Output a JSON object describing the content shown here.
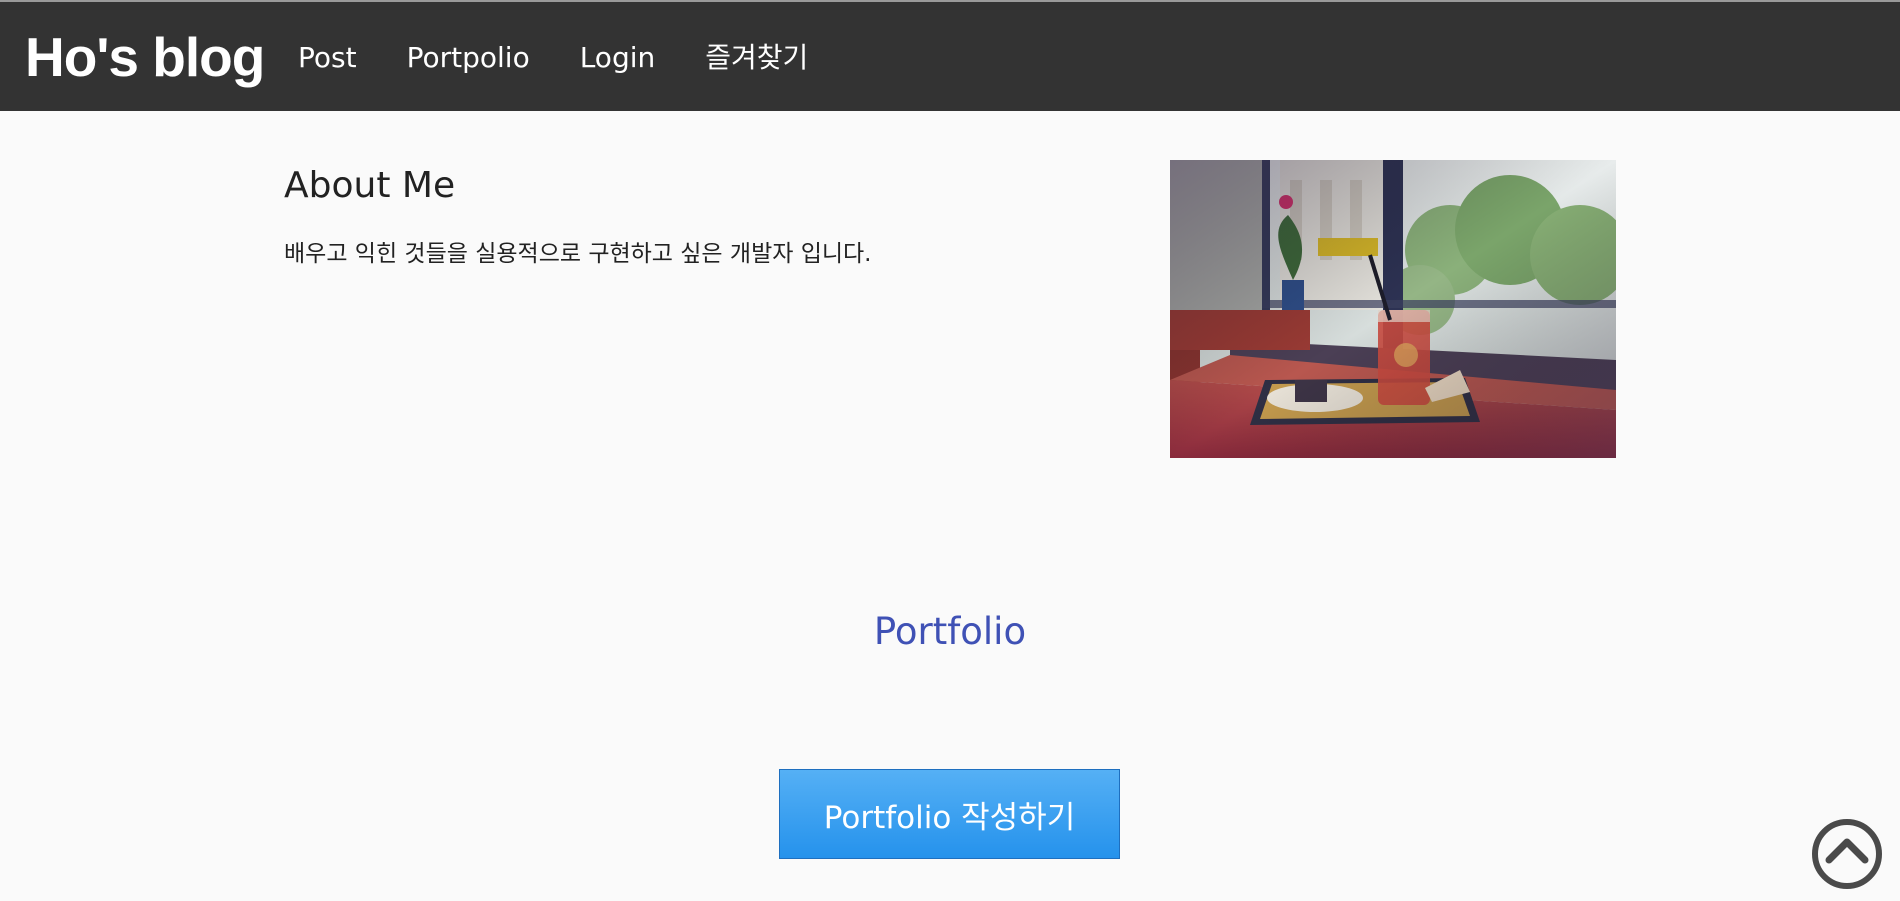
{
  "header": {
    "brand": "Ho's blog",
    "nav": [
      {
        "label": "Post"
      },
      {
        "label": "Portpolio"
      },
      {
        "label": "Login"
      },
      {
        "label": "즐겨찾기"
      }
    ]
  },
  "about": {
    "title": "About Me",
    "description": "배우고 익힌 것들을 실용적으로 구현하고 싶은 개발자 입니다."
  },
  "portfolio": {
    "heading": "Portfolio",
    "write_button": "Portfolio 작성하기"
  },
  "colors": {
    "topbar": "#333333",
    "accent_heading": "#3f51b5",
    "button": "#2592ec",
    "background": "#fafafa"
  },
  "icons": {
    "scroll_top": "chevron-up-circle-icon"
  }
}
